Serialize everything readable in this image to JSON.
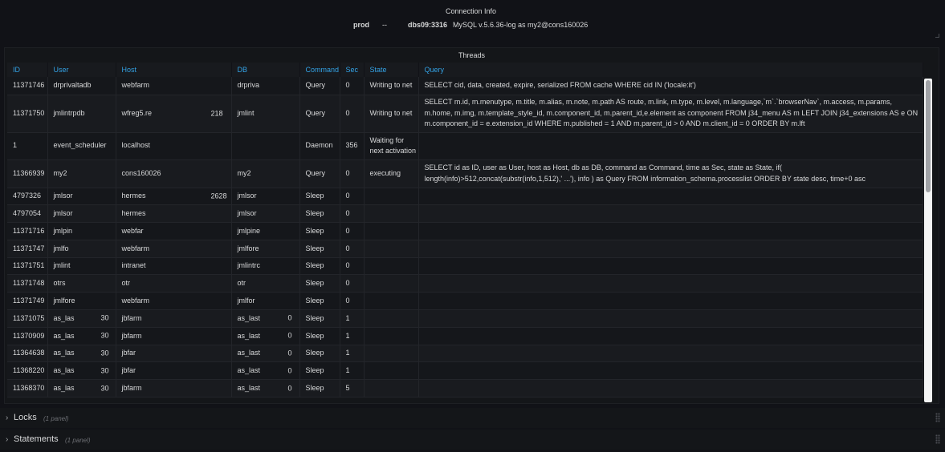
{
  "connection": {
    "title": "Connection Info",
    "env": "prod",
    "separator": "--",
    "host": "dbs09:3316",
    "version": "MySQL v.5.6.36-log as my2@cons160026"
  },
  "threads": {
    "title": "Threads",
    "columns": [
      "ID",
      "User",
      "Host",
      "DB",
      "Command",
      "Sec",
      "State",
      "Query"
    ],
    "rows": [
      {
        "id": "11371746",
        "user": "drprivaltadb",
        "host": "webfarm",
        "host_num": "",
        "db": "drpriva",
        "db_num": "",
        "user_num": "",
        "command": "Query",
        "sec": "0",
        "state": "Writing to net",
        "query": "SELECT cid, data, created, expire, serialized FROM cache WHERE cid IN ('locale:it')"
      },
      {
        "id": "11371750",
        "user": "jmlintrpdb",
        "host": "wfreg5.re",
        "host_num": "218",
        "db": "jmlint",
        "db_num": "",
        "user_num": "",
        "command": "Query",
        "sec": "0",
        "state": "Writing to net",
        "query": "SELECT m.id, m.menutype, m.title, m.alias, m.note, m.path AS route, m.link, m.type, m.level, m.language,`m`.`browserNav`, m.access, m.params, m.home, m.img, m.template_style_id, m.component_id, m.parent_id,e.element as component FROM j34_menu AS m LEFT JOIN j34_extensions AS e ON m.component_id = e.extension_id WHERE m.published = 1 AND m.parent_id > 0 AND m.client_id = 0 ORDER BY m.lft"
      },
      {
        "id": "1",
        "user": "event_scheduler",
        "host": "localhost",
        "host_num": "",
        "db": "",
        "db_num": "",
        "user_num": "",
        "command": "Daemon",
        "sec": "356",
        "state": "Waiting for next activation",
        "query": ""
      },
      {
        "id": "11366939",
        "user": "my2",
        "host": "cons160026",
        "host_num": "",
        "db": "my2",
        "db_num": "",
        "user_num": "",
        "command": "Query",
        "sec": "0",
        "state": "executing",
        "query": "SELECT id as ID, user as User, host as Host, db as DB, command as Command, time as Sec, state as State, if( length(info)>512,concat(substr(info,1,512),' ...'), info ) as Query FROM information_schema.processlist ORDER BY state desc, time+0 asc"
      },
      {
        "id": "4797326",
        "user": "jmlsor",
        "host": "hermes",
        "host_num": "2628",
        "db": "jmlsor",
        "db_num": "",
        "user_num": "",
        "command": "Sleep",
        "sec": "0",
        "state": "",
        "query": ""
      },
      {
        "id": "4797054",
        "user": "jmlsor",
        "host": "hermes",
        "host_num": "",
        "db": "jmlsor",
        "db_num": "",
        "user_num": "",
        "command": "Sleep",
        "sec": "0",
        "state": "",
        "query": ""
      },
      {
        "id": "11371716",
        "user": "jmlpin",
        "host": "webfar",
        "host_num": "",
        "db": "jmlpine",
        "db_num": "",
        "user_num": "",
        "command": "Sleep",
        "sec": "0",
        "state": "",
        "query": ""
      },
      {
        "id": "11371747",
        "user": "jmlfo",
        "host": "webfarm",
        "host_num": "",
        "db": "jmlfore",
        "db_num": "",
        "user_num": "",
        "command": "Sleep",
        "sec": "0",
        "state": "",
        "query": ""
      },
      {
        "id": "11371751",
        "user": "jmlint",
        "host": "intranet",
        "host_num": "",
        "db": "jmlintrc",
        "db_num": "",
        "user_num": "",
        "command": "Sleep",
        "sec": "0",
        "state": "",
        "query": ""
      },
      {
        "id": "11371748",
        "user": "otrs",
        "host": "otr",
        "host_num": "",
        "db": "otr",
        "db_num": "",
        "user_num": "",
        "command": "Sleep",
        "sec": "0",
        "state": "",
        "query": ""
      },
      {
        "id": "11371749",
        "user": "jmlfore",
        "host": "webfarm",
        "host_num": "",
        "db": "jmlfor",
        "db_num": "",
        "user_num": "",
        "command": "Sleep",
        "sec": "0",
        "state": "",
        "query": ""
      },
      {
        "id": "11371075",
        "user": "as_las",
        "user_num": "30",
        "host": "jbfarm",
        "host_num": "",
        "db": "as_last",
        "db_num": "0",
        "command": "Sleep",
        "sec": "1",
        "state": "",
        "query": ""
      },
      {
        "id": "11370909",
        "user": "as_las",
        "user_num": "30",
        "host": "jbfarm",
        "host_num": "",
        "db": "as_last",
        "db_num": "0",
        "command": "Sleep",
        "sec": "1",
        "state": "",
        "query": ""
      },
      {
        "id": "11364638",
        "user": "as_las",
        "user_num": "30",
        "host": "jbfar",
        "host_num": "",
        "db": "as_last",
        "db_num": "0",
        "command": "Sleep",
        "sec": "1",
        "state": "",
        "query": ""
      },
      {
        "id": "11368220",
        "user": "as_las",
        "user_num": "30",
        "host": "jbfar",
        "host_num": "",
        "db": "as_last",
        "db_num": "0",
        "command": "Sleep",
        "sec": "1",
        "state": "",
        "query": ""
      },
      {
        "id": "11368370",
        "user": "as_las",
        "user_num": "30",
        "host": "jbfarm",
        "host_num": "",
        "db": "as_last",
        "db_num": "0",
        "command": "Sleep",
        "sec": "5",
        "state": "",
        "query": ""
      }
    ]
  },
  "rows_collapsed": [
    {
      "title": "Locks",
      "count": "(1 panel)"
    },
    {
      "title": "Statements",
      "count": "(1 panel)"
    }
  ],
  "colors": {
    "background": "#111217",
    "header_text": "#33a2e5",
    "text": "#d8d9da"
  }
}
